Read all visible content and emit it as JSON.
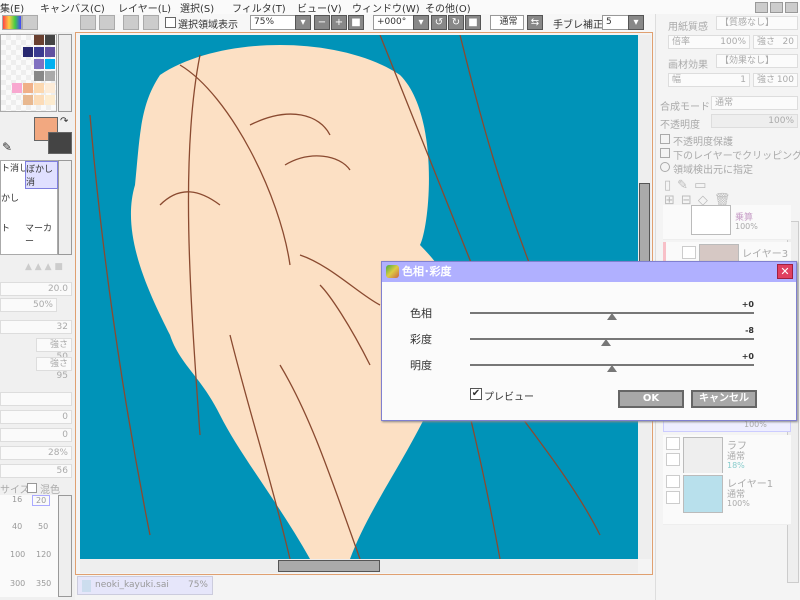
{
  "menu": [
    "集(E)",
    "キャンバス(C)",
    "レイヤー(L)",
    "選択(S)",
    "フィルタ(T)",
    "ビュー(V)",
    "ウィンドウ(W)",
    "その他(O)"
  ],
  "toolbar": {
    "show_selection": "選択領域表示",
    "zoom": "75%",
    "rotation": "+000°",
    "blend": "通常",
    "stabilizer_label": "手ブレ補正",
    "stabilizer": "5"
  },
  "colors": {
    "canvas_bg": "#0093b8",
    "skin": "#fce0c4",
    "line": "#8a4a30",
    "primary": "#f2a880",
    "secondary": "#444444",
    "accent": "#b0b0ff"
  },
  "tools": [
    "ト消し",
    "ぼかし消",
    "かし",
    "",
    "ト",
    "マーカー"
  ],
  "brush_params": [
    "20.0",
    "50%",
    "32",
    "強さ 50",
    "強さ 95",
    "0",
    "0",
    "28%",
    "56"
  ],
  "size_row": {
    "label": "サイズ",
    "mix": "混色"
  },
  "brush_sizes": [
    "16",
    "20",
    "40",
    "50",
    "100",
    "120",
    "300",
    "350"
  ],
  "right_panel": {
    "paper_label": "用紙質感",
    "paper": "【質感なし】",
    "scale_label": "倍率",
    "scale": "100%",
    "strength_label": "強さ",
    "strength1": "20",
    "effect_label": "画材効果",
    "effect": "【効果なし】",
    "width_label": "幅",
    "width": "1",
    "strength2": "100",
    "blend_label": "合成モード",
    "blend": "通常",
    "opacity_label": "不透明度",
    "opacity": "100%",
    "protect": "不透明度保護",
    "clip": "下のレイヤーでクリッピング",
    "region": "領域検出元に指定"
  },
  "layers": [
    {
      "name": "",
      "mode": "乗算",
      "opacity": "100%"
    },
    {
      "name": "レイヤー3",
      "mode": "",
      "opacity": ""
    },
    {
      "name": "",
      "mode": "",
      "opacity": "100%"
    },
    {
      "name": "ラフ",
      "mode": "通常",
      "opacity": "18%"
    },
    {
      "name": "レイヤー1",
      "mode": "通常",
      "opacity": "100%"
    }
  ],
  "doc_tab": {
    "name": "neoki_kayuki.sai",
    "zoom": "75%"
  },
  "dialog": {
    "title": "色相･彩度",
    "sliders": [
      {
        "label": "色相",
        "value": "+0",
        "level": 0
      },
      {
        "label": "彩度",
        "value": "-8",
        "level": -8
      },
      {
        "label": "明度",
        "value": "+0",
        "level": 0
      }
    ],
    "preview": "プレビュー",
    "ok": "OK",
    "cancel": "キャンセル"
  }
}
